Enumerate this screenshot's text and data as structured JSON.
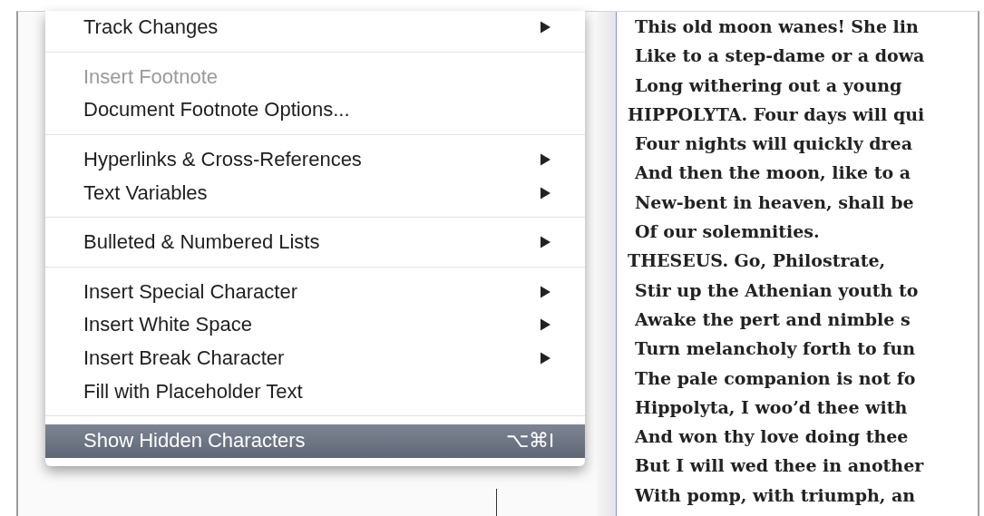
{
  "menu": {
    "items": [
      {
        "kind": "item",
        "label": "Track Changes",
        "submenu": true,
        "disabled": false,
        "selected": false
      },
      {
        "kind": "separator"
      },
      {
        "kind": "item",
        "label": "Insert Footnote",
        "submenu": false,
        "disabled": true,
        "selected": false
      },
      {
        "kind": "item",
        "label": "Document Footnote Options...",
        "submenu": false,
        "disabled": false,
        "selected": false
      },
      {
        "kind": "separator"
      },
      {
        "kind": "item",
        "label": "Hyperlinks & Cross-References",
        "submenu": true,
        "disabled": false,
        "selected": false
      },
      {
        "kind": "item",
        "label": "Text Variables",
        "submenu": true,
        "disabled": false,
        "selected": false
      },
      {
        "kind": "separator"
      },
      {
        "kind": "item",
        "label": "Bulleted & Numbered Lists",
        "submenu": true,
        "disabled": false,
        "selected": false
      },
      {
        "kind": "separator"
      },
      {
        "kind": "item",
        "label": "Insert Special Character",
        "submenu": true,
        "disabled": false,
        "selected": false
      },
      {
        "kind": "item",
        "label": "Insert White Space",
        "submenu": true,
        "disabled": false,
        "selected": false
      },
      {
        "kind": "item",
        "label": "Insert Break Character",
        "submenu": true,
        "disabled": false,
        "selected": false
      },
      {
        "kind": "item",
        "label": "Fill with Placeholder Text",
        "submenu": false,
        "disabled": false,
        "selected": false
      },
      {
        "kind": "separator"
      },
      {
        "kind": "item",
        "label": "Show Hidden Characters",
        "shortcut": "⌥⌘I",
        "submenu": false,
        "disabled": false,
        "selected": true
      }
    ]
  },
  "document": {
    "lines": [
      {
        "kind": "verse",
        "text": "This old moon wanes! She lin"
      },
      {
        "kind": "verse",
        "text": "Like to a step-dame or a dowa"
      },
      {
        "kind": "verse",
        "text": "Long withering out a young"
      },
      {
        "kind": "speaker",
        "text": "HIPPOLYTA. Four days will qui"
      },
      {
        "kind": "verse",
        "text": "Four nights will quickly drea"
      },
      {
        "kind": "verse",
        "text": "And then the moon, like to a"
      },
      {
        "kind": "verse",
        "text": "New-bent in heaven, shall be"
      },
      {
        "kind": "verse",
        "text": "Of our solemnities."
      },
      {
        "kind": "speaker",
        "text": "THESEUS. Go, Philostrate,"
      },
      {
        "kind": "verse",
        "text": "Stir up the Athenian youth to"
      },
      {
        "kind": "verse",
        "text": "Awake the pert and nimble s"
      },
      {
        "kind": "verse",
        "text": "Turn melancholy forth to fun"
      },
      {
        "kind": "verse",
        "text": "The pale companion is not fo"
      },
      {
        "kind": "verse",
        "text": "Hippolyta, I woo’d thee with"
      },
      {
        "kind": "verse",
        "text": "And won thy love doing thee"
      },
      {
        "kind": "verse",
        "text": "But I will wed thee in another"
      },
      {
        "kind": "verse",
        "text": "With pomp, with triumph, an"
      }
    ]
  }
}
